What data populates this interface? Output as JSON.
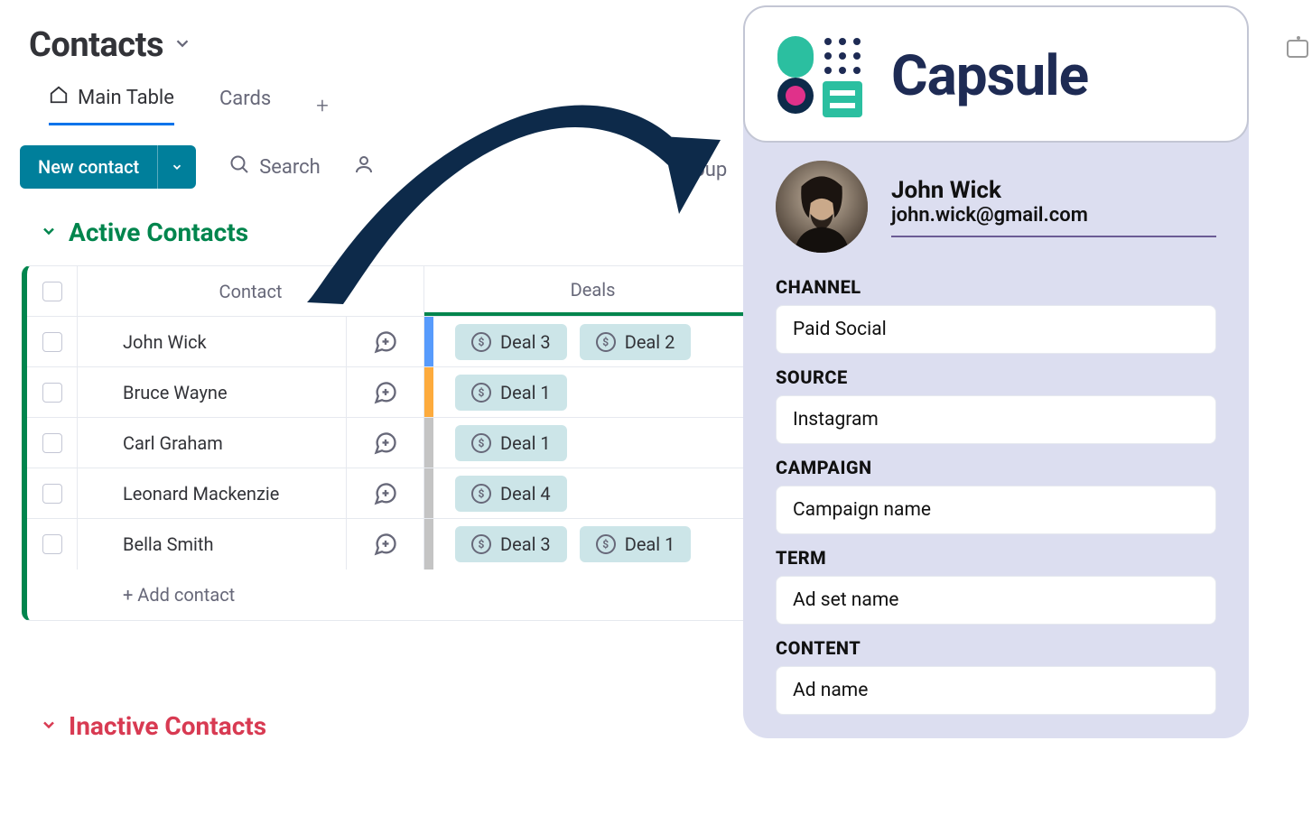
{
  "header": {
    "title": "Contacts"
  },
  "tabs": [
    {
      "label": "Main Table",
      "active": true
    },
    {
      "label": "Cards",
      "active": false
    }
  ],
  "toolbar": {
    "new_label": "New contact",
    "search_label": "Search",
    "group_label": "Group"
  },
  "sections": {
    "active": {
      "label": "Active Contacts"
    },
    "inactive": {
      "label": "Inactive Contacts"
    }
  },
  "columns": {
    "contact": "Contact",
    "deals": "Deals"
  },
  "rows": [
    {
      "name": "John Wick",
      "bar": "#579bfc",
      "deals": [
        "Deal 3",
        "Deal 2"
      ]
    },
    {
      "name": "Bruce Wayne",
      "bar": "#fdab3d",
      "deals": [
        "Deal 1"
      ]
    },
    {
      "name": "Carl Graham",
      "bar": "#c4c4c4",
      "deals": [
        "Deal 1"
      ]
    },
    {
      "name": "Leonard Mackenzie",
      "bar": "#c4c4c4",
      "deals": [
        "Deal 4"
      ]
    },
    {
      "name": "Bella Smith",
      "bar": "#c4c4c4",
      "deals": [
        "Deal 3",
        "Deal 1"
      ]
    }
  ],
  "add_contact_label": "+ Add contact",
  "detail": {
    "brand": "Capsule",
    "name": "John Wick",
    "email": "john.wick@gmail.com",
    "fields": [
      {
        "label": "CHANNEL",
        "value": "Paid Social"
      },
      {
        "label": "SOURCE",
        "value": "Instagram"
      },
      {
        "label": "CAMPAIGN",
        "value": "Campaign name"
      },
      {
        "label": "TERM",
        "value": "Ad set name"
      },
      {
        "label": "CONTENT",
        "value": "Ad name"
      }
    ]
  }
}
